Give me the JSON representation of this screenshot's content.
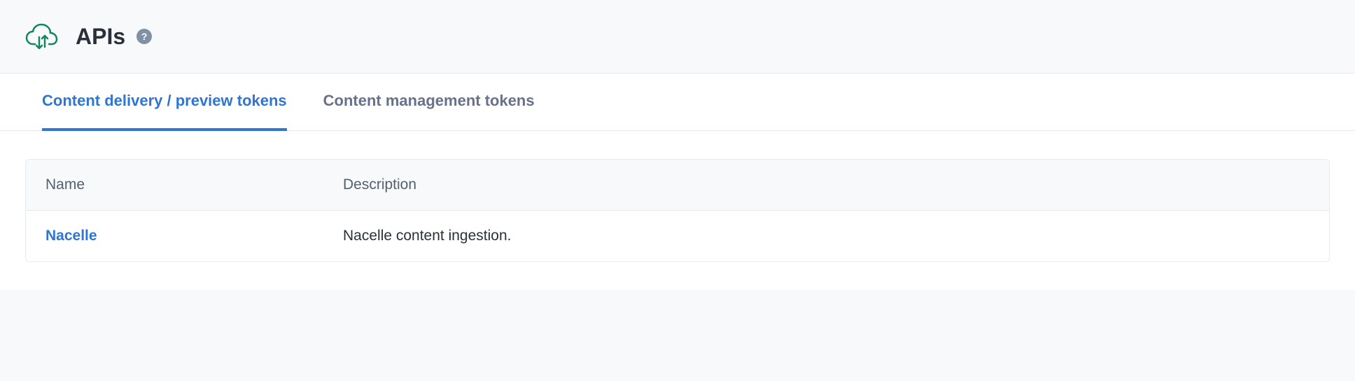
{
  "header": {
    "title": "APIs"
  },
  "tabs": [
    {
      "label": "Content delivery / preview tokens",
      "active": true
    },
    {
      "label": "Content management tokens",
      "active": false
    }
  ],
  "table": {
    "headers": {
      "name": "Name",
      "description": "Description"
    },
    "rows": [
      {
        "name": "Nacelle",
        "description": "Nacelle content ingestion."
      }
    ]
  }
}
